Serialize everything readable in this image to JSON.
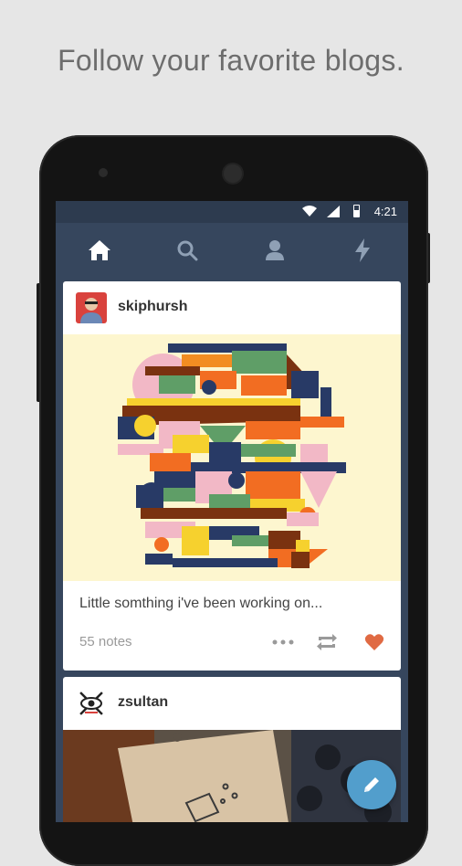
{
  "headline": "Follow your favorite blogs.",
  "status_bar": {
    "time": "4:21"
  },
  "nav": {
    "items": [
      {
        "name": "home",
        "icon": "home-icon",
        "active": true
      },
      {
        "name": "search",
        "icon": "search-icon",
        "active": false
      },
      {
        "name": "account",
        "icon": "person-icon",
        "active": false
      },
      {
        "name": "activity",
        "icon": "lightning-icon",
        "active": false
      }
    ]
  },
  "posts": [
    {
      "username": "skiphursh",
      "caption": "Little somthing i've been working on...",
      "notes": "55 notes",
      "liked": true
    },
    {
      "username": "zsultan"
    }
  ],
  "colors": {
    "background": "#e6e6e6",
    "dashboard": "#36465d",
    "like_active": "#e06a43",
    "fab": "#529ecc"
  },
  "fab": {
    "icon": "pencil-icon"
  }
}
